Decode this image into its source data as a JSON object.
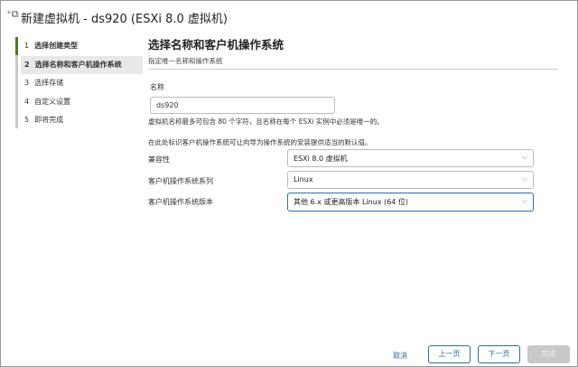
{
  "window": {
    "title": "新建虚拟机 - ds920 (ESXi 8.0 虚拟机)"
  },
  "steps": [
    {
      "num": "1",
      "label": "选择创建类型"
    },
    {
      "num": "2",
      "label": "选择名称和客户机操作系统"
    },
    {
      "num": "3",
      "label": "选择存储"
    },
    {
      "num": "4",
      "label": "自定义设置"
    },
    {
      "num": "5",
      "label": "即将完成"
    }
  ],
  "main": {
    "title": "选择名称和客户机操作系统",
    "subtitle": "指定唯一名称和操作系统",
    "name_label": "名称",
    "name_value": "ds920",
    "name_hint": "虚拟机名称最多可包含 80 个字符，且名称在每个 ESXi 实例中必须是唯一的。",
    "os_hint": "在此处标识客户机操作系统可让向导为操作系统的安装提供适当的默认值。",
    "fields": [
      {
        "label": "兼容性",
        "value": "ESXi 8.0 虚拟机"
      },
      {
        "label": "客户机操作系统系列",
        "value": "Linux"
      },
      {
        "label": "客户机操作系统版本",
        "value": "其他 6.x 或更高版本 Linux (64 位)"
      }
    ]
  },
  "footer": {
    "cancel": "取消",
    "back": "上一页",
    "next": "下一页",
    "finish": "完成"
  }
}
